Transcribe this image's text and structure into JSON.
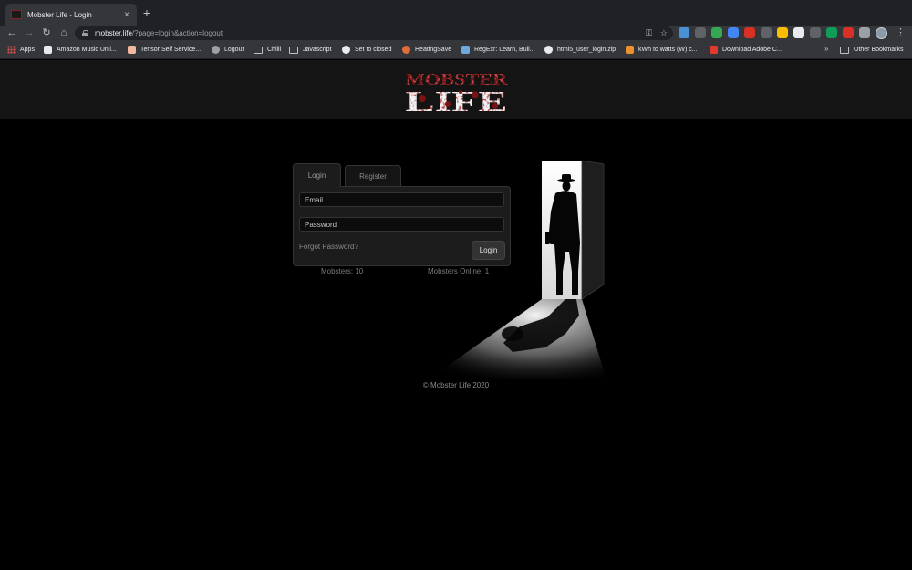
{
  "browser": {
    "tab_title": "Mobster Life - Login",
    "close_glyph": "×",
    "new_tab_glyph": "+",
    "url_host": "mobster.life",
    "url_path": "/?page=login&action=logout",
    "nav": {
      "back": "←",
      "forward": "→",
      "reload": "↻",
      "home": "⌂"
    },
    "key_glyph": "⚿",
    "star_glyph": "☆",
    "menu_glyph": "⋮",
    "extensions": [
      "#4a90d9",
      "#5f6368",
      "#34a853",
      "#4285f4",
      "#d93025",
      "#5f6368",
      "#fbbc04",
      "#e8eaed",
      "#5f6368",
      "#0f9d58",
      "#d93025",
      "#9aa0a6"
    ]
  },
  "bookmarks": {
    "items": [
      {
        "label": "Apps",
        "icon": "apps-grid-icon"
      },
      {
        "label": "Amazon Music Unli...",
        "icon": "amazon-icon"
      },
      {
        "label": "Tensor Self Service...",
        "icon": "tensor-icon"
      },
      {
        "label": "Logout",
        "icon": "logout-icon"
      },
      {
        "label": "Chilli",
        "icon": "folder-icon"
      },
      {
        "label": "Javascript",
        "icon": "folder-icon"
      },
      {
        "label": "Set to closed",
        "icon": "globe-icon"
      },
      {
        "label": "HeatingSave",
        "icon": "heatingsave-icon"
      },
      {
        "label": "RegExr: Learn, Buil...",
        "icon": "regexr-icon"
      },
      {
        "label": "html5_user_login.zip",
        "icon": "globe-icon"
      },
      {
        "label": "kWh to watts (W) c...",
        "icon": "rapidtables-icon"
      },
      {
        "label": "Download Adobe C...",
        "icon": "adobe-icon"
      }
    ],
    "overflow": "»",
    "other": "Other Bookmarks"
  },
  "site": {
    "logo_top": "MOBSTER",
    "logo_bottom": "LIFE",
    "tabs": {
      "login": "Login",
      "register": "Register"
    },
    "email_placeholder": "Email",
    "password_placeholder": "Password",
    "forgot": "Forgot Password?",
    "login_button": "Login",
    "mobsters": "Mobsters: 10",
    "online": "Mobsters Online: 1",
    "footer": "© Mobster Life 2020"
  }
}
